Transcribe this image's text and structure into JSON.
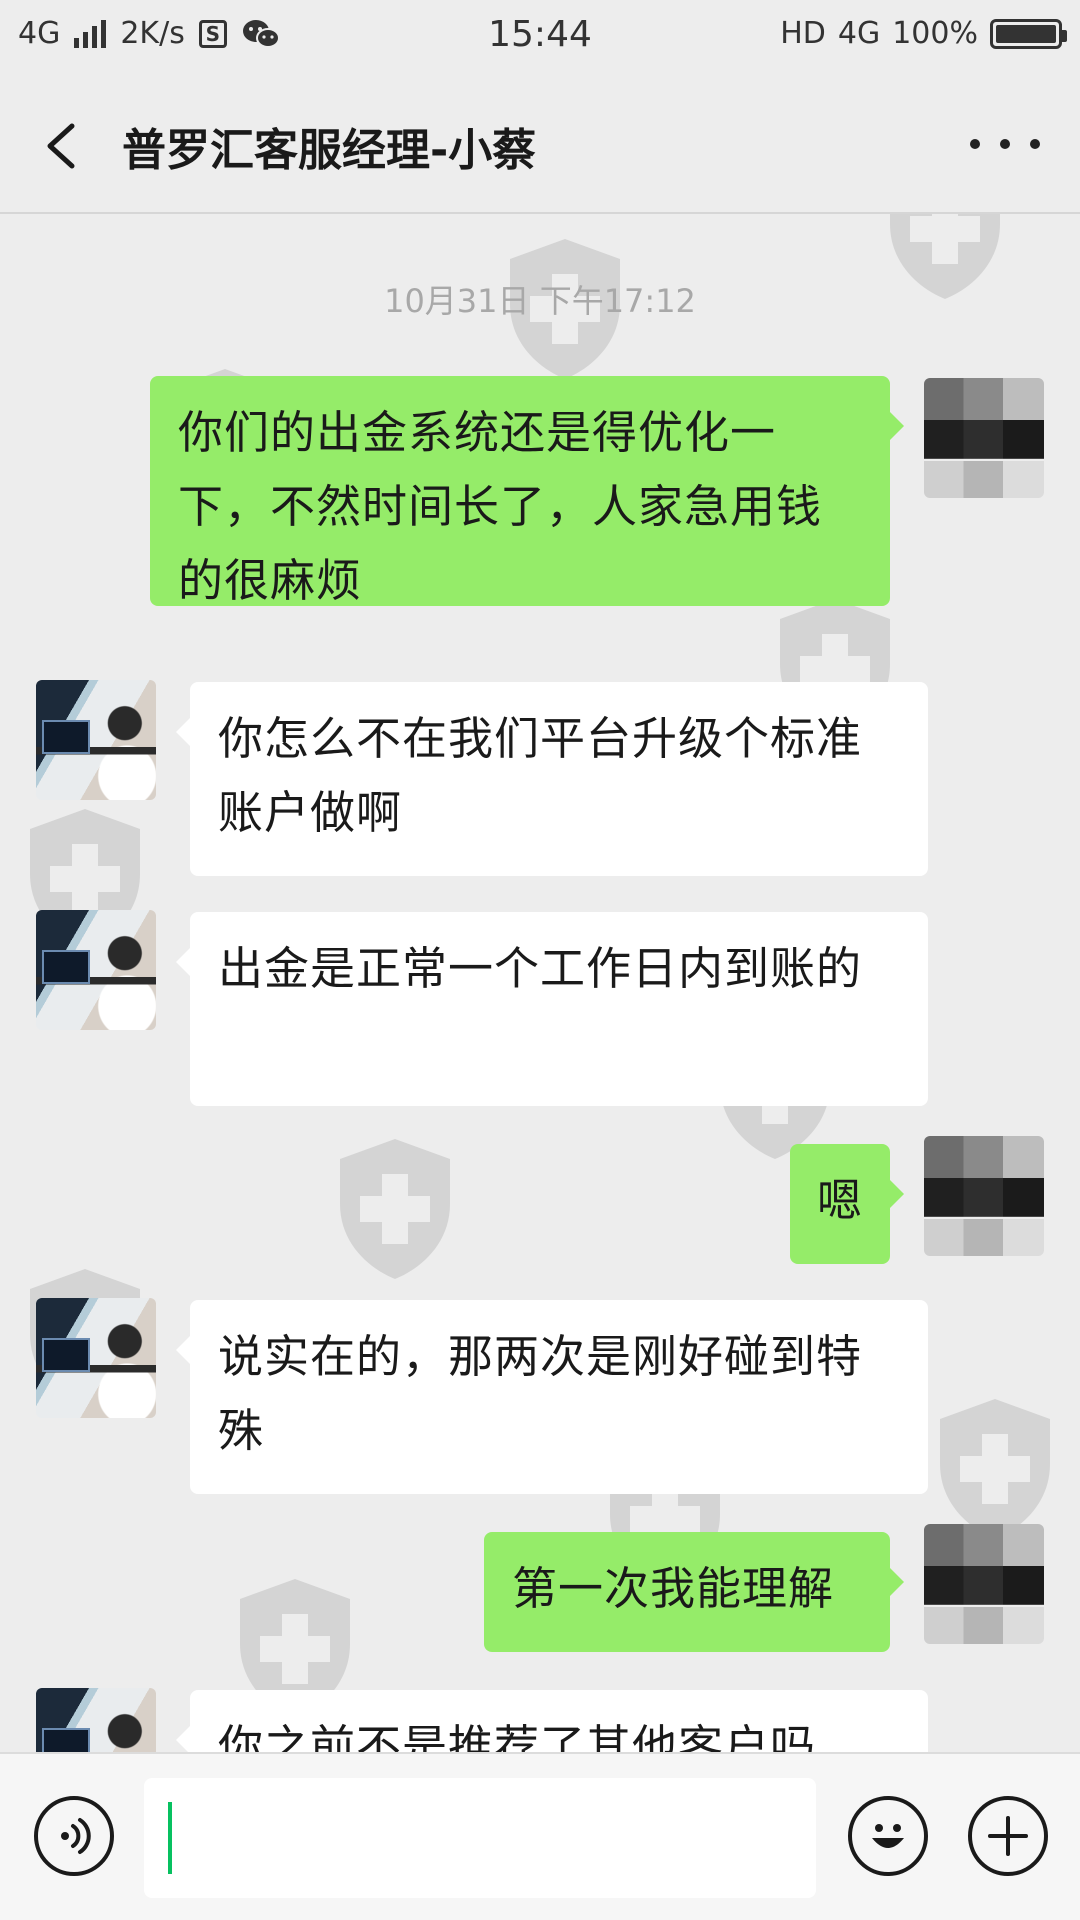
{
  "status_bar": {
    "network": "4G",
    "speed": "2K/s",
    "time": "15:44",
    "hd_label": "HD",
    "network_right": "4G",
    "battery": "100%",
    "battery_level": 1.0
  },
  "header": {
    "title": "普罗汇客服经理-小蔡",
    "back_icon": "chevron-left-icon",
    "more_icon": "more-dots-icon"
  },
  "chat": {
    "timestamp": "10月31日 下午17:12",
    "messages": [
      {
        "sender": "me",
        "text": "你们的出金系统还是得优化一下，不然时间长了，人家急用钱的很麻烦"
      },
      {
        "sender": "staff",
        "text": "你怎么不在我们平台升级个标准账户做啊"
      },
      {
        "sender": "staff",
        "text": "出金是正常一个工作日内到账的"
      },
      {
        "sender": "me",
        "text": "嗯"
      },
      {
        "sender": "staff",
        "text": "说实在的，那两次是刚好碰到特殊"
      },
      {
        "sender": "me",
        "text": "第一次我能理解"
      },
      {
        "sender": "staff",
        "text": "你之前不是推荐了其他客户吗"
      }
    ]
  },
  "input_bar": {
    "voice_icon": "voice-icon",
    "emoji_icon": "emoji-icon",
    "plus_icon": "plus-icon",
    "input_value": "",
    "cursor_color": "#07c160"
  },
  "colors": {
    "background": "#ededed",
    "bubble_out": "#95ec69",
    "bubble_in": "#ffffff"
  }
}
